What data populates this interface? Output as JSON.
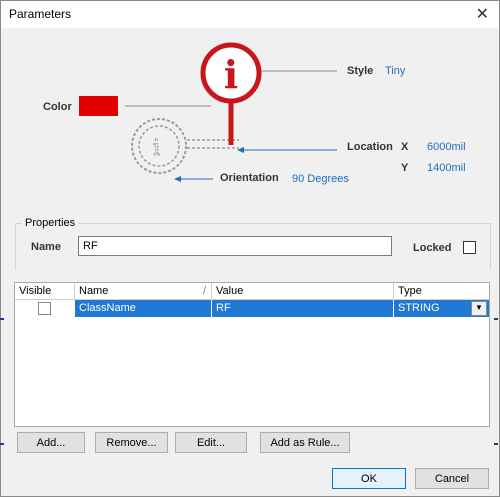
{
  "window": {
    "title": "Parameters",
    "close_glyph": "✕"
  },
  "diagram": {
    "color_label": "Color",
    "color_swatch": "#e00000",
    "style_label": "Style",
    "style_value": "Tiny",
    "location_label": "Location",
    "x_label": "X",
    "x_value": "6000mil",
    "y_label": "Y",
    "y_value": "1400mil",
    "orientation_label": "Orientation",
    "orientation_value": "90 Degrees",
    "marker_glyph": "i"
  },
  "properties": {
    "group_label": "Properties",
    "name_label": "Name",
    "name_value": "RF",
    "locked_label": "Locked"
  },
  "table": {
    "headers": [
      "Visible",
      "Name",
      "Value",
      "Type"
    ],
    "sort_glyph": "/",
    "rows": [
      {
        "name": "ClassName",
        "value": "RF",
        "type": "STRING"
      }
    ]
  },
  "buttons": {
    "add": "Add...",
    "remove": "Remove...",
    "edit": "Edit...",
    "add_as_rule": "Add as Rule...",
    "ok": "OK",
    "cancel": "Cancel"
  }
}
